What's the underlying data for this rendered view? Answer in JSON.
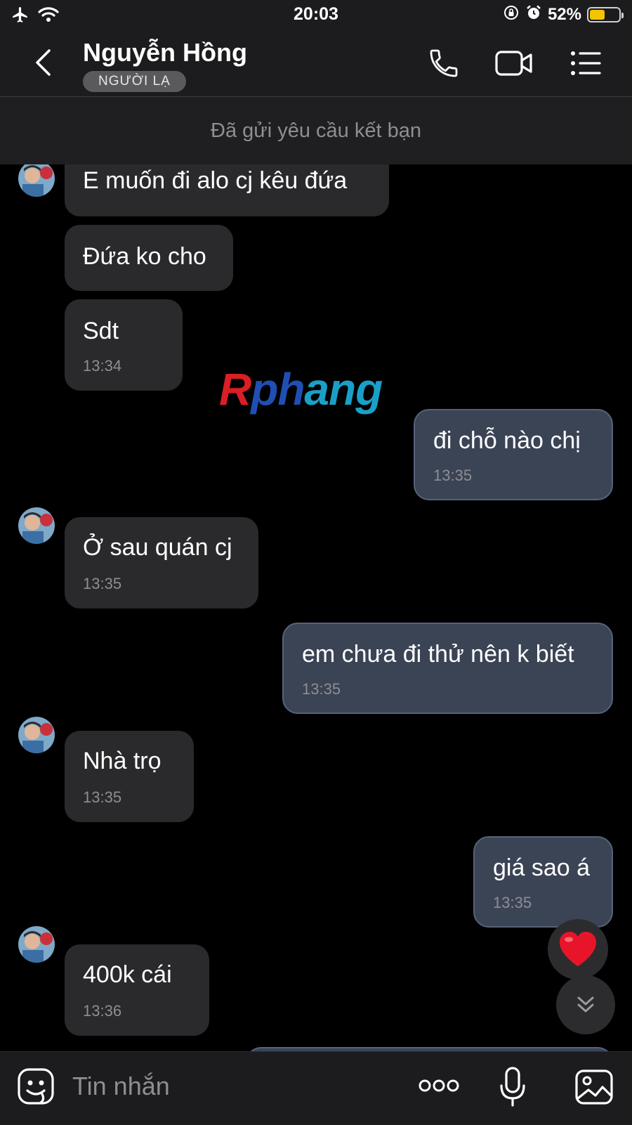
{
  "status_bar": {
    "time": "20:03",
    "battery_percent": "52%",
    "battery_level": 0.52,
    "icons": [
      "airplane-icon",
      "wifi-icon",
      "orientation-lock-icon",
      "alarm-icon",
      "battery-icon"
    ]
  },
  "header": {
    "contact_name": "Nguyễn Hồng",
    "badge": "NGƯỜI LẠ",
    "icons": [
      "back-icon",
      "phone-icon",
      "video-camera-icon",
      "menu-list-icon"
    ]
  },
  "friend_request": {
    "text": "Đã gửi yêu cầu kết bạn"
  },
  "messages": [
    {
      "direction": "in",
      "text": "E muốn đi alo cj kêu đứa",
      "time": ""
    },
    {
      "direction": "in",
      "text": "Đứa ko cho",
      "time": ""
    },
    {
      "direction": "in",
      "text": "Sdt",
      "time": "13:34"
    },
    {
      "direction": "out",
      "text": "đi chỗ nào chị",
      "time": "13:35"
    },
    {
      "direction": "in",
      "text": "Ở sau quán cj",
      "time": "13:35"
    },
    {
      "direction": "out",
      "text": "em chưa đi thử nên k biết",
      "time": "13:35"
    },
    {
      "direction": "in",
      "text": "Nhà trọ",
      "time": "13:35"
    },
    {
      "direction": "out",
      "text": "giá sao á",
      "time": "13:35"
    },
    {
      "direction": "in",
      "text": "400k cái",
      "time": "13:36"
    }
  ],
  "watermark": {
    "part1": "R",
    "part2": "ph",
    "part3": "ang"
  },
  "input_bar": {
    "placeholder": "Tin nhắn",
    "icons": [
      "sticker-icon",
      "more-icon",
      "microphone-icon",
      "image-icon"
    ]
  },
  "colors": {
    "background": "#000000",
    "bar": "#1c1c1e",
    "incoming_bubble": "#2a2a2c",
    "outgoing_bubble": "#3b4455",
    "timestamp": "#8e8e93",
    "battery": "#f5c400"
  }
}
